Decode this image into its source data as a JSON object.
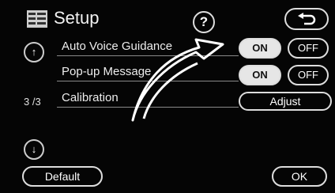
{
  "header": {
    "title": "Setup",
    "help_label": "?"
  },
  "rows": [
    {
      "label": "Auto Voice Guidance",
      "on_label": "ON",
      "off_label": "OFF",
      "selected": "ON"
    },
    {
      "label": "Pop-up Message",
      "on_label": "ON",
      "off_label": "OFF",
      "selected": "ON"
    },
    {
      "label": "Calibration",
      "action_label": "Adjust"
    }
  ],
  "page_indicator": "3 /3",
  "scroll": {
    "up_label": "↑",
    "down_label": "↓"
  },
  "footer": {
    "default_label": "Default",
    "ok_label": "OK"
  },
  "icons": {
    "setup": "setup-menu-icon",
    "back": "return-arrow-icon",
    "scroll_up": "scroll-up-icon",
    "scroll_down": "scroll-down-icon",
    "overlay": "pointer-arrow-icon"
  },
  "colors": {
    "background": "#050505",
    "button_on": "#e6e6e6",
    "border": "#dddddd"
  }
}
